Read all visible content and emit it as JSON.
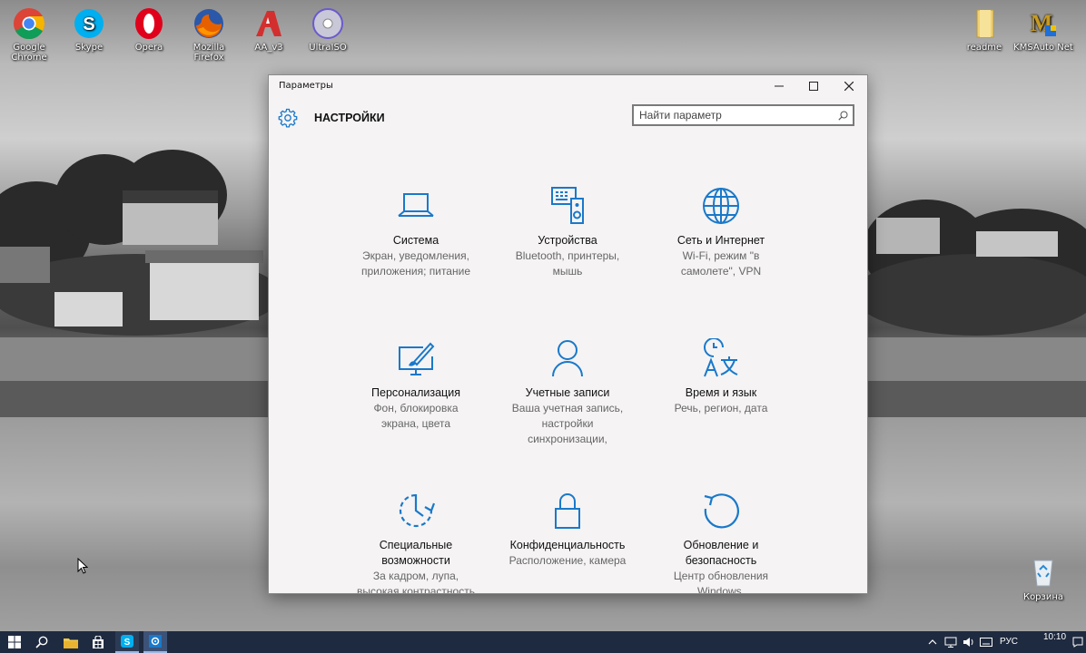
{
  "desktop": {
    "icons_left": [
      {
        "label": "Google Chrome",
        "icon": "chrome-icon"
      },
      {
        "label": "Skype",
        "icon": "skype-icon"
      },
      {
        "label": "Opera",
        "icon": "opera-icon"
      },
      {
        "label": "Mozilla Firefox",
        "icon": "firefox-icon"
      },
      {
        "label": "AA_v3",
        "icon": "ammyy-admin-icon"
      },
      {
        "label": "UltraISO",
        "icon": "ultraiso-icon"
      }
    ],
    "icons_right": [
      {
        "label": "readme",
        "icon": "folder-icon"
      },
      {
        "label": "KMSAuto Net",
        "icon": "kmsauto-icon"
      }
    ],
    "recycle_bin": {
      "label": "Корзина",
      "icon": "recycle-bin-icon"
    }
  },
  "window": {
    "title": "Параметры",
    "header_title": "НАСТРОЙКИ",
    "search_placeholder": "Найти параметр",
    "accent_color": "#1979ca",
    "categories": [
      {
        "icon": "laptop-icon",
        "title": "Система",
        "desc": [
          "Экран, уведомления,",
          "приложения; питание"
        ]
      },
      {
        "icon": "devices-icon",
        "title": "Устройства",
        "desc": [
          "Bluetooth, принтеры,",
          "мышь"
        ]
      },
      {
        "icon": "globe-icon",
        "title": "Сеть и Интернет",
        "desc": [
          "Wi-Fi, режим \"в",
          "самолете\", VPN"
        ]
      },
      {
        "icon": "personalization-icon",
        "title": "Персонализация",
        "desc": [
          "Фон, блокировка",
          "экрана, цвета"
        ]
      },
      {
        "icon": "person-icon",
        "title": "Учетные записи",
        "desc": [
          "Ваша учетная запись,",
          "настройки",
          "синхронизации,"
        ]
      },
      {
        "icon": "time-language-icon",
        "title": "Время и язык",
        "desc": [
          "Речь, регион, дата"
        ]
      },
      {
        "icon": "accessibility-icon",
        "title": "Специальные",
        "title2": "возможности",
        "desc": [
          "За кадром, лупа,",
          "высокая контрастность"
        ]
      },
      {
        "icon": "lock-icon",
        "title": "Конфиденциальность",
        "desc": [
          "Расположение, камера"
        ]
      },
      {
        "icon": "update-icon",
        "title": "Обновление и",
        "title2": "безопасность",
        "desc": [
          "Центр обновления",
          "Windows,"
        ]
      }
    ]
  },
  "taskbar": {
    "language": "РУС",
    "time": "10:10"
  }
}
